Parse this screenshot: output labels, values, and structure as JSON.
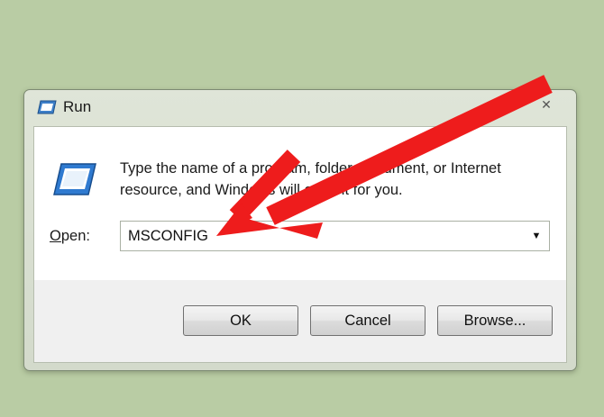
{
  "window": {
    "title": "Run",
    "close_glyph": "✕"
  },
  "dialog": {
    "description": "Type the name of a program, folder, document, or Internet resource, and Windows will open it for you.",
    "open_label_prefix": "",
    "open_label_accel": "O",
    "open_label_rest": "pen:",
    "combo_value": "MSCONFIG",
    "combo_arrow": "▼"
  },
  "buttons": {
    "ok": "OK",
    "cancel": "Cancel",
    "browse": "Browse..."
  },
  "icons": {
    "title_icon": "run-icon",
    "body_icon": "run-icon",
    "close_icon": "close-icon",
    "dropdown_icon": "chevron-down-icon"
  },
  "colors": {
    "background": "#b9cca4",
    "arrow": "#ee1c1c",
    "window_frame": "#d3dacb"
  }
}
